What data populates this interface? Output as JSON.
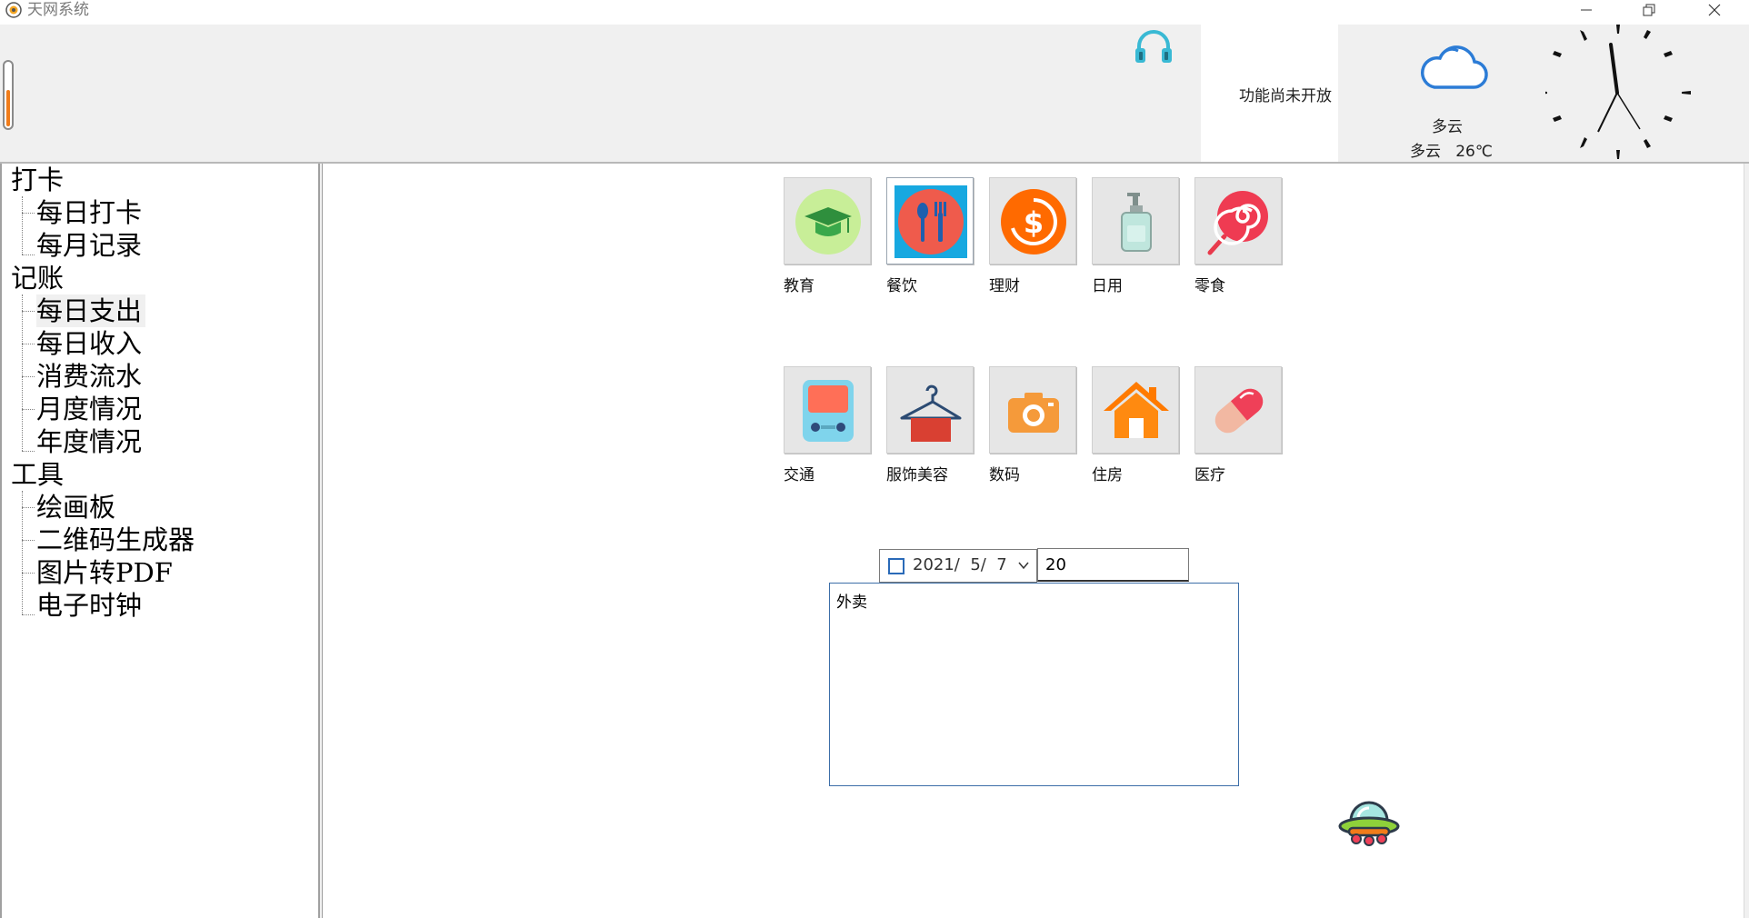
{
  "window": {
    "title": "天网系统",
    "icon": "app-logo-icon",
    "controls": [
      "minimize-icon",
      "restore-icon",
      "close-icon"
    ]
  },
  "header": {
    "music_icon": "headphones-icon",
    "thermometer_level": 0.55,
    "notice": "功能尚未开放",
    "weather": {
      "icon": "cloud-icon",
      "condition": "多云",
      "summary": "多云   26℃"
    },
    "clock_icon": "analog-clock"
  },
  "tree": {
    "groups": [
      {
        "label": "打卡",
        "children": [
          "每日打卡",
          "每月记录"
        ]
      },
      {
        "label": "记账",
        "children": [
          "每日支出",
          "每日收入",
          "消费流水",
          "月度情况",
          "年度情况"
        ]
      },
      {
        "label": "工具",
        "children": [
          "绘画板",
          "二维码生成器",
          "图片转PDF",
          "电子时钟"
        ]
      }
    ],
    "selected": "每日支出"
  },
  "categories": {
    "row1": [
      {
        "label": "教育",
        "icon": "graduation-cap-icon"
      },
      {
        "label": "餐饮",
        "icon": "fork-spoon-icon"
      },
      {
        "label": "理财",
        "icon": "dollar-coin-icon"
      },
      {
        "label": "日用",
        "icon": "soap-bottle-icon"
      },
      {
        "label": "零食",
        "icon": "lollipop-icon"
      }
    ],
    "row2": [
      {
        "label": "交通",
        "icon": "bus-icon"
      },
      {
        "label": "服饰美容",
        "icon": "hanger-icon"
      },
      {
        "label": "数码",
        "icon": "camera-icon"
      },
      {
        "label": "住房",
        "icon": "house-icon"
      },
      {
        "label": "医疗",
        "icon": "pill-icon"
      }
    ],
    "selected": "餐饮"
  },
  "form": {
    "date": "2021/  5/  7",
    "amount": "20",
    "note": "外卖"
  },
  "decor": {
    "mascot_icon": "ufo-icon"
  },
  "colors": {
    "accent": "#ff6a00",
    "tree_selected_bg": "#f0f0f0",
    "input_border": "#3c6ea8"
  }
}
